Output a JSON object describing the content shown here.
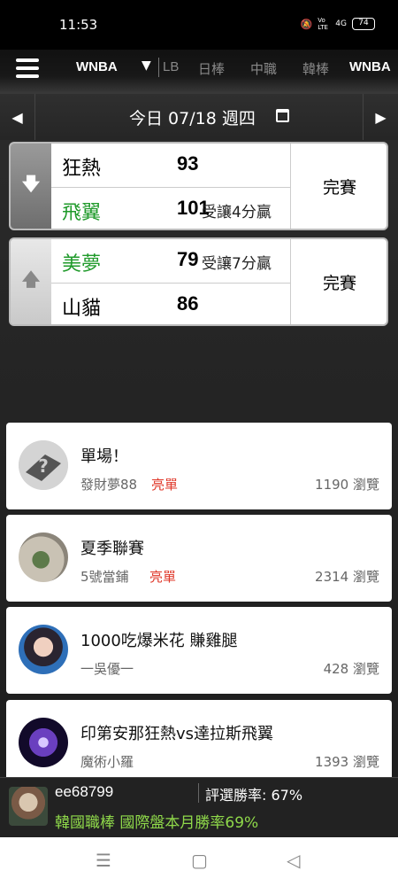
{
  "status_bar": {
    "time": "11:53",
    "battery": "74",
    "signal_label": "4G",
    "volte_label": "Vo LTE"
  },
  "top_nav": {
    "current_league": "WNBA",
    "tabs": [
      "LB",
      "日棒",
      "中職",
      "韓棒",
      "WNBA"
    ]
  },
  "date_bar": {
    "date_text": "今日 07/18 週四",
    "prev_label": "◀",
    "next_label": "▶"
  },
  "games": [
    {
      "teams": [
        {
          "name": "狂熱",
          "score": "93",
          "note": "",
          "color": "#000000"
        },
        {
          "name": "飛翼",
          "score": "101",
          "note": "受讓4分贏",
          "color": "#1f9a2a"
        }
      ],
      "status": "完賽"
    },
    {
      "teams": [
        {
          "name": "美夢",
          "score": "79",
          "note": "受讓7分贏",
          "color": "#1f9a2a"
        },
        {
          "name": "山貓",
          "score": "86",
          "note": "",
          "color": "#000000"
        }
      ],
      "status": "完賽"
    }
  ],
  "posts": [
    {
      "title": "單場！",
      "author": "發財夢88",
      "badge": "亮單",
      "views": "1190 瀏覽"
    },
    {
      "title": "夏季聯賽",
      "author": "5號當鋪",
      "badge": "亮單",
      "views": "2314 瀏覽"
    },
    {
      "title": "1000吃爆米花 賺雞腿",
      "author": "一吳優一",
      "badge": "",
      "views": "428 瀏覽"
    },
    {
      "title": "印第安那狂熱vs達拉斯飛翼",
      "author": "魔術小羅",
      "badge": "",
      "views": "1393 瀏覽"
    }
  ],
  "promo": {
    "user": "ee68799",
    "rate": "評選勝率: 67%",
    "text": "韓國職棒 國際盤本月勝率69%"
  },
  "colors": {
    "accent_green": "#1f9a2a",
    "badge_red": "#e0392b",
    "promo_green": "#8fd94a"
  }
}
